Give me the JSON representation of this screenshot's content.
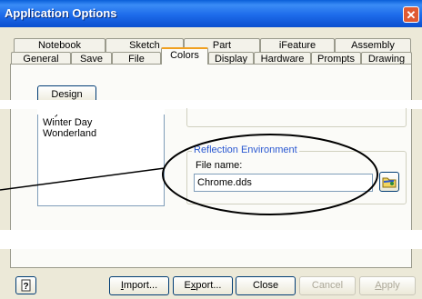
{
  "window": {
    "title": "Application Options",
    "close_glyph": "✕"
  },
  "tabs_row1": [
    {
      "label": "Notebook"
    },
    {
      "label": "Sketch"
    },
    {
      "label": "Part"
    },
    {
      "label": "iFeature"
    },
    {
      "label": "Assembly"
    }
  ],
  "tabs_row2": [
    {
      "label": "General"
    },
    {
      "label": "Save"
    },
    {
      "label": "File"
    },
    {
      "label": "Colors",
      "active": true
    },
    {
      "label": "Display"
    },
    {
      "label": "Hardware"
    },
    {
      "label": "Prompts"
    },
    {
      "label": "Drawing"
    }
  ],
  "colors_tab": {
    "design_button": "Design",
    "color_schemes": [
      "Sky",
      "Winter Day",
      "Wonderland"
    ],
    "reflection": {
      "group_label": "Reflection Environment",
      "file_label": "File name:",
      "file_value": "Chrome.dds",
      "browse_icon": "browse-folder-icon"
    }
  },
  "footer": {
    "help_icon": "help-icon",
    "import": {
      "pre": "",
      "key": "I",
      "post": "mport..."
    },
    "export": {
      "pre": "E",
      "key": "x",
      "post": "port..."
    },
    "close": "Close",
    "cancel": "Cancel",
    "apply": {
      "pre": "",
      "key": "A",
      "post": "pply"
    }
  },
  "colors": {
    "accent": "#0b4fcf",
    "group_label": "#2a58d1",
    "annotation": "#000000"
  }
}
